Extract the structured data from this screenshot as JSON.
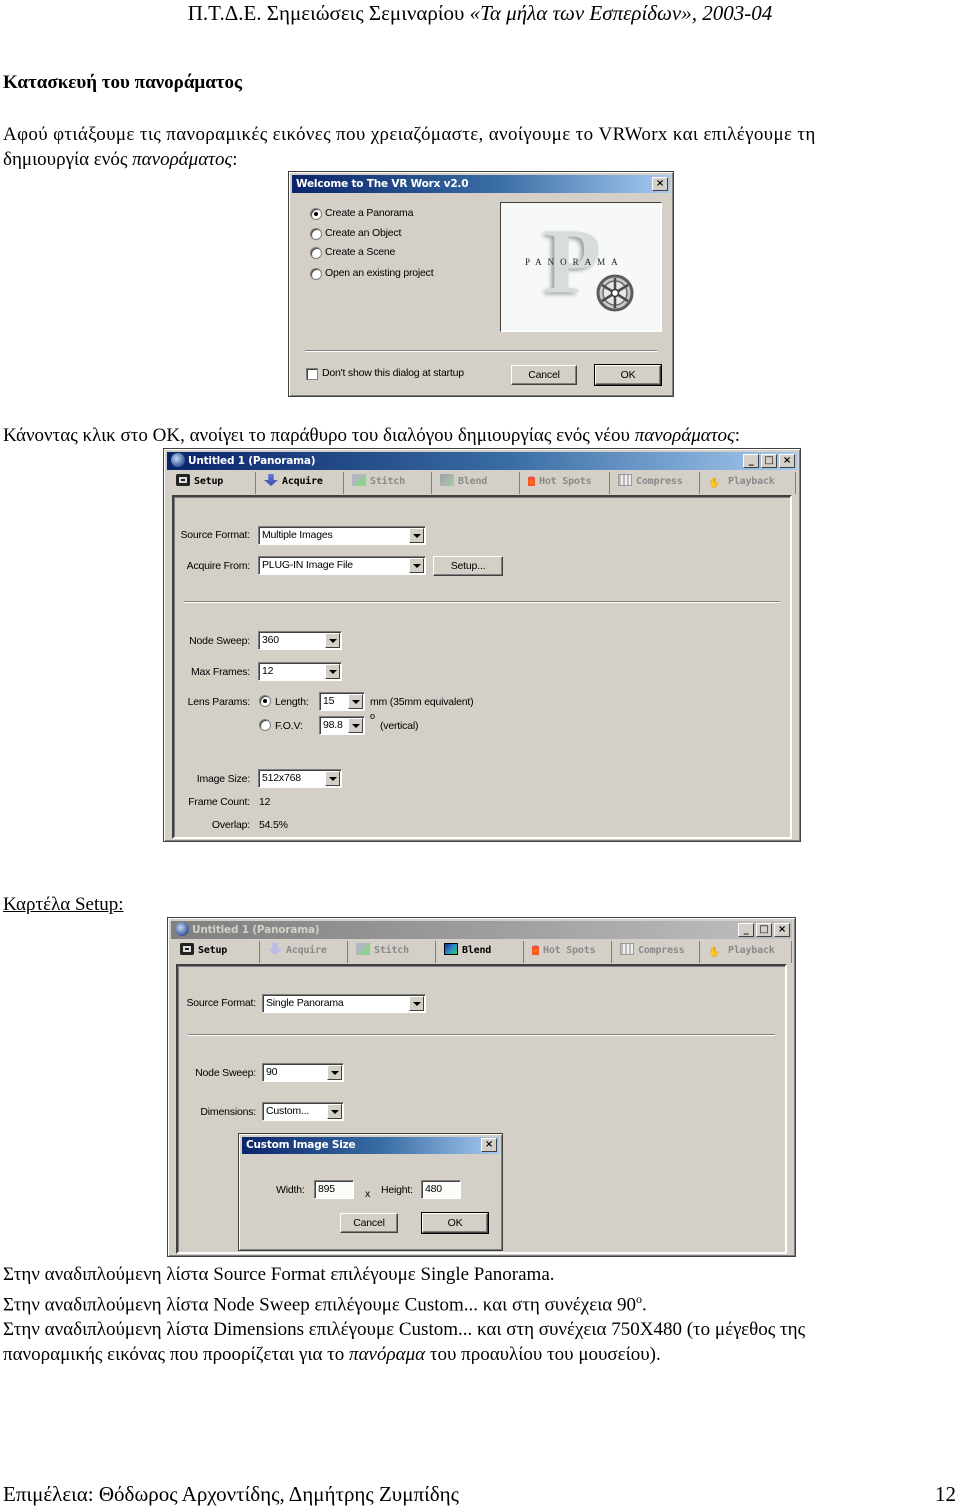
{
  "header": {
    "prefix": "Π.Τ.Δ.Ε.  Σημειώσεις Σεμιναρίου ",
    "italic": "«Τα μήλα των Εσπερίδων», 2003-04"
  },
  "heading": "Κατασκευή του πανοράματος",
  "intro": {
    "line1": "Αφού φτιάξουμε τις πανοραμικές εικόνες που χρειαζόμαστε, ανοίγουμε το VRWorx και επιλέγουμε τη",
    "line2_plain": "δημιουργία ενός ",
    "line2_italic": "πανοράματος",
    "line2_end": ":"
  },
  "welcome_dialog": {
    "title": "Welcome to The VR Worx v2.0",
    "options": [
      {
        "label": "Create a Panorama",
        "selected": true
      },
      {
        "label": "Create an Object",
        "selected": false
      },
      {
        "label": "Create a Scene",
        "selected": false
      },
      {
        "label": "Open an existing project",
        "selected": false
      }
    ],
    "logo_text": "PANORAMA",
    "logo_letter": "P",
    "dont_show_label": "Don't show this dialog at startup",
    "dont_show_checked": false,
    "cancel_label": "Cancel",
    "ok_label": "OK"
  },
  "para2": {
    "plain": "Κάνοντας κλικ στο OK, ανοίγει το παράθυρο του διαλόγου δημιουργίας ενός νέου ",
    "italic": "πανοράματος",
    "end": ":"
  },
  "window1": {
    "title": "Untitled 1 (Panorama)",
    "title_active": true,
    "controls": {
      "minimize": "_",
      "maximize": "□",
      "close": "×"
    },
    "tabs": [
      {
        "label": "Setup",
        "icon": "camera-icon",
        "enabled": true,
        "active": true
      },
      {
        "label": "Acquire",
        "icon": "down-arrow-icon",
        "enabled": true,
        "active": false
      },
      {
        "label": "Stitch",
        "icon": "stitch-icon",
        "enabled": false,
        "active": false
      },
      {
        "label": "Blend",
        "icon": "blend-icon",
        "enabled": false,
        "active": false
      },
      {
        "label": "Hot Spots",
        "icon": "flame-icon",
        "enabled": false,
        "active": false
      },
      {
        "label": "Compress",
        "icon": "film-icon",
        "enabled": false,
        "active": false
      },
      {
        "label": "Playback",
        "icon": "hand-icon",
        "enabled": false,
        "active": false
      }
    ],
    "source_format_label": "Source Format:",
    "source_format_value": "Multiple Images",
    "acquire_from_label": "Acquire From:",
    "acquire_from_value": "PLUG-IN Image File",
    "setup_button": "Setup...",
    "node_sweep_label": "Node Sweep:",
    "node_sweep_value": "360",
    "max_frames_label": "Max Frames:",
    "max_frames_value": "12",
    "lens_params_label": "Lens Params:",
    "length_label": "Length:",
    "length_value": "15",
    "length_unit": "mm (35mm equivalent)",
    "length_selected": true,
    "fov_label": "F.O.V:",
    "fov_value": "98.8",
    "fov_unit_symbol": "o",
    "fov_unit": "(vertical)",
    "image_size_label": "Image Size:",
    "image_size_value": "512x768",
    "frame_count_label": "Frame Count:",
    "frame_count_value": "12",
    "overlap_label": "Overlap:",
    "overlap_value": "54.5%"
  },
  "para3": "Καρτέλα Setup:",
  "window2": {
    "title": "Untitled 1 (Panorama)",
    "title_active": false,
    "controls": {
      "minimize": "_",
      "maximize": "□",
      "close": "×"
    },
    "tabs": [
      {
        "label": "Setup",
        "icon": "camera-icon",
        "enabled": true,
        "active": true
      },
      {
        "label": "Acquire",
        "icon": "down-arrow-icon",
        "enabled": false,
        "active": false
      },
      {
        "label": "Stitch",
        "icon": "stitch-icon",
        "enabled": false,
        "active": false
      },
      {
        "label": "Blend",
        "icon": "blend-icon",
        "enabled": true,
        "active": false
      },
      {
        "label": "Hot Spots",
        "icon": "flame-icon",
        "enabled": false,
        "active": false
      },
      {
        "label": "Compress",
        "icon": "film-icon",
        "enabled": false,
        "active": false
      },
      {
        "label": "Playback",
        "icon": "hand-icon",
        "enabled": false,
        "active": false
      }
    ],
    "source_format_label": "Source Format:",
    "source_format_value": "Single Panorama",
    "node_sweep_label": "Node Sweep:",
    "node_sweep_value": "90",
    "dimensions_label": "Dimensions:",
    "dimensions_value": "Custom..."
  },
  "custom_dialog": {
    "title": "Custom Image Size",
    "close": "×",
    "width_label": "Width:",
    "width_value": "895",
    "x_label": "x",
    "height_label": "Height:",
    "height_value": "480",
    "cancel_label": "Cancel",
    "ok_label": "OK"
  },
  "instructions": {
    "line1": "Στην αναδιπλούμενη λίστα Source Format επιλέγουμε Single Panorama.",
    "line2_plain": "Στην αναδιπλούμενη λίστα Node Sweep επιλέγουμε Custom... και στη συνέχεια 90",
    "line2_sup": "o",
    "line2_end": ".",
    "line3": "Στην αναδιπλούμενη λίστα Dimensions επιλέγουμε Custom... και στη συνέχεια 750X480 (το μέγεθος της",
    "line4_plain": "πανοραμικής εικόνας που προορίζεται για το ",
    "line4_italic": "πανόραμα",
    "line4_end": " του προαυλίου του μουσείου)."
  },
  "footer": {
    "credits": "Επιμέλεια: Θόδωρος Αρχοντίδης, Δημήτρης Ζυμπίδης",
    "page_number": "12"
  }
}
